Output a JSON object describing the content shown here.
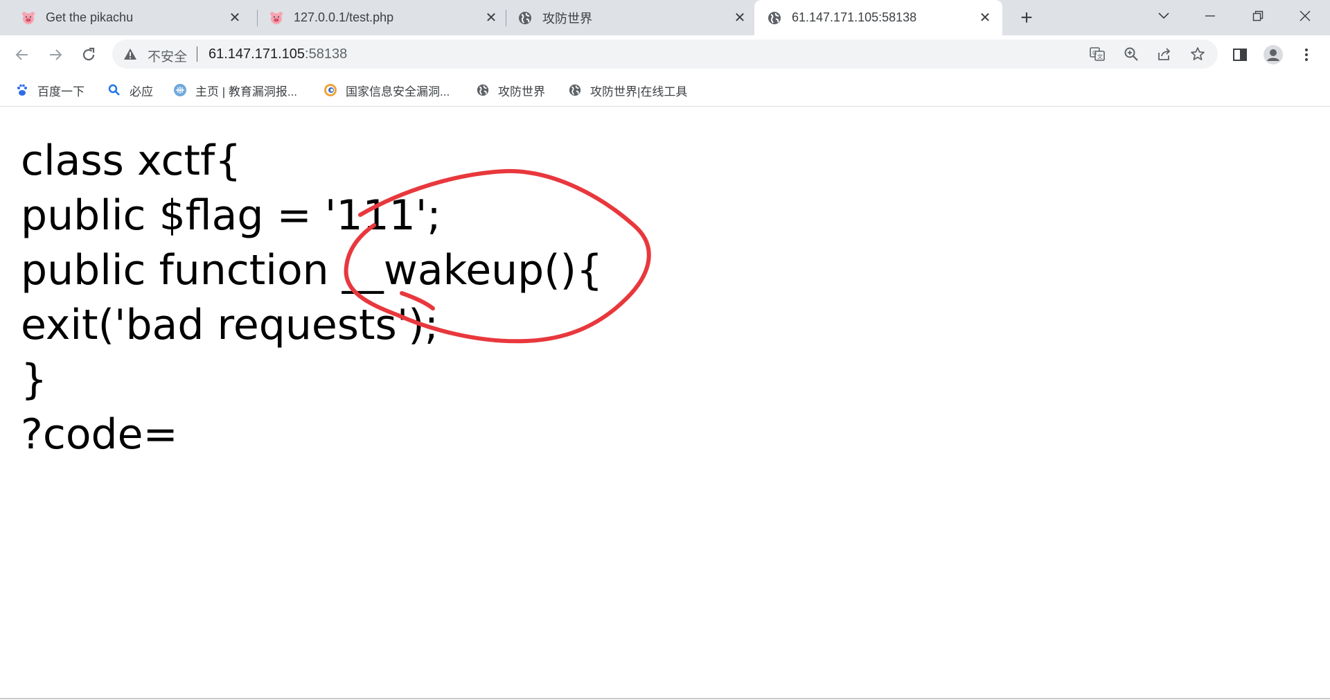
{
  "tabs": [
    {
      "title": "Get the pikachu",
      "favicon": "pig-icon"
    },
    {
      "title": "127.0.0.1/test.php",
      "favicon": "pig-icon"
    },
    {
      "title": "攻防世界",
      "favicon": "globe-icon"
    },
    {
      "title": "61.147.171.105:58138",
      "favicon": "globe-icon",
      "active": true
    }
  ],
  "omnibox": {
    "security_label": "不安全",
    "url_host": "61.147.171.105",
    "url_port": ":58138"
  },
  "bookmarks": [
    {
      "label": "百度一下",
      "icon": "baidu-paw-icon"
    },
    {
      "label": "必应",
      "icon": "search-icon"
    },
    {
      "label": "主页 | 教育漏洞报...",
      "icon": "edusrc-icon"
    },
    {
      "label": "国家信息安全漏洞...",
      "icon": "cnvd-icon"
    },
    {
      "label": "攻防世界",
      "icon": "globe-icon"
    },
    {
      "label": "攻防世界|在线工具",
      "icon": "globe-icon"
    }
  ],
  "page": {
    "lines": [
      "class xctf{",
      "public $flag = '111';",
      "public function __wakeup(){",
      "exit('bad requests');",
      "}",
      "?code="
    ]
  },
  "colors": {
    "tabstrip_bg": "#dee1e6",
    "omnibox_bg": "#f1f3f4",
    "annotation_red": "#e8383d"
  }
}
